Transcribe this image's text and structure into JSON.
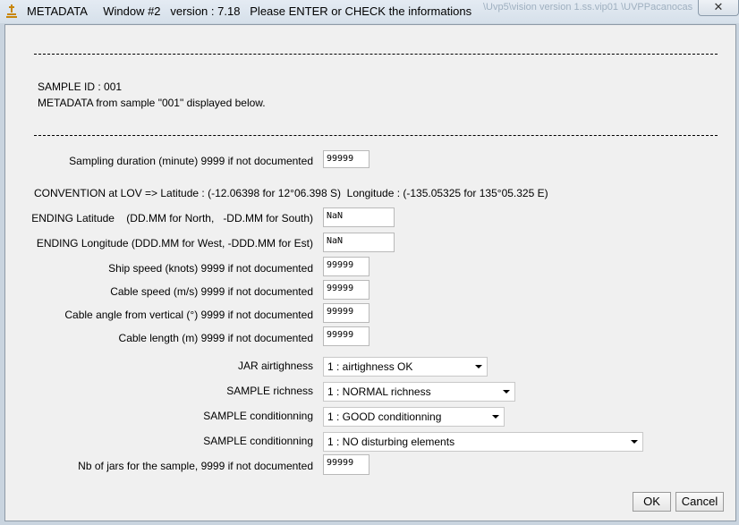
{
  "window": {
    "title": "METADATA     Window #2   version : 7.18   Please ENTER or CHECK the informations",
    "close_label": "✕",
    "background_text": "\\Uvp5\\vision  version 1.ss.vip01  \\UVPPacanocas"
  },
  "header": {
    "sample_id": "SAMPLE ID : 001",
    "metadata_note": "METADATA from sample \"001\" displayed below."
  },
  "convention_text": "CONVENTION at LOV => Latitude : (-12.06398 for 12°06.398 S)  Longitude : (-135.05325 for 135°05.325 E)",
  "fields": {
    "sampling_duration": {
      "label": "Sampling duration (minute) 9999 if not documented",
      "value": "99999"
    },
    "ending_latitude": {
      "label": "ENDING Latitude    (DD.MM for North,   -DD.MM for South)",
      "value": "NaN"
    },
    "ending_longitude": {
      "label": "ENDING Longitude (DDD.MM for West, -DDD.MM for Est)",
      "value": "NaN"
    },
    "ship_speed": {
      "label": "Ship speed (knots) 9999 if not documented",
      "value": "99999"
    },
    "cable_speed": {
      "label": "Cable speed (m/s) 9999 if not documented",
      "value": "99999"
    },
    "cable_angle": {
      "label": "Cable angle from vertical (°) 9999 if not documented",
      "value": "99999"
    },
    "cable_length": {
      "label": "Cable length (m) 9999 if not documented",
      "value": "99999"
    },
    "nb_jars": {
      "label": "Nb of jars for the sample, 9999 if not documented",
      "value": "99999"
    }
  },
  "selects": {
    "jar_airtightness": {
      "label": "JAR airtighness",
      "value": "1 : airtighness OK"
    },
    "sample_richness": {
      "label": "SAMPLE richness",
      "value": "1 : NORMAL richness"
    },
    "sample_conditioning": {
      "label": "SAMPLE conditionning",
      "value": "1 : GOOD conditionning"
    },
    "sample_disturbing": {
      "label": "SAMPLE conditionning",
      "value": "1 : NO disturbing elements"
    }
  },
  "buttons": {
    "ok": "OK",
    "cancel": "Cancel"
  }
}
